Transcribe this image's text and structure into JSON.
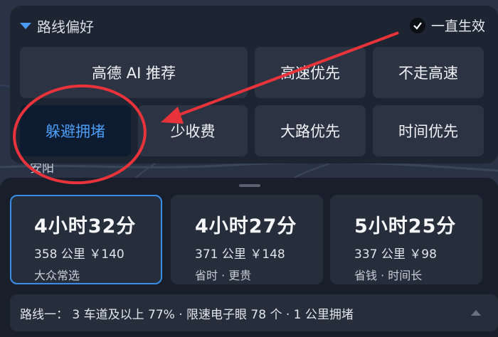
{
  "preference": {
    "title": "路线偏好",
    "always_label": "一直生效",
    "options": [
      {
        "label": "高德 AI 推荐",
        "active": false
      },
      {
        "label": "高速优先",
        "active": false
      },
      {
        "label": "不走高速",
        "active": false
      },
      {
        "label": "躲避拥堵",
        "active": true
      },
      {
        "label": "少收费",
        "active": false
      },
      {
        "label": "大路优先",
        "active": false
      },
      {
        "label": "时间优先",
        "active": false
      }
    ]
  },
  "map": {
    "label": "安阳"
  },
  "routes": [
    {
      "time": "4小时32分",
      "meta": "358 公里 ￥140",
      "tag": "大众常选",
      "selected": true
    },
    {
      "time": "4小时27分",
      "meta": "371 公里 ￥148",
      "tag": "省时 · 更贵",
      "selected": false
    },
    {
      "time": "5小时25分",
      "meta": "337 公里 ￥98",
      "tag": "省钱 · 时间长",
      "selected": false
    }
  ],
  "route_info": "路线一：  3 车道及以上 77% · 限速电子眼 78 个 · 1 公里拥堵",
  "colors": {
    "accent": "#4a9cf5",
    "annotation": "#e8333b",
    "panel": "#1e2532"
  }
}
